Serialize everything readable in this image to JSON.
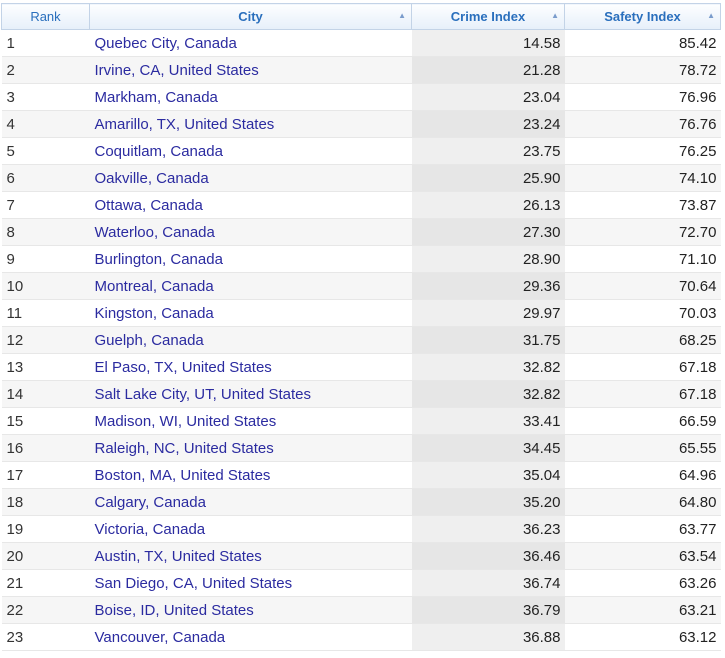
{
  "headers": {
    "rank": "Rank",
    "city": "City",
    "crime": "Crime Index",
    "safety": "Safety Index",
    "sort_glyph": "▲"
  },
  "rows": [
    {
      "rank": "1",
      "city": "Quebec City, Canada",
      "crime": "14.58",
      "safety": "85.42"
    },
    {
      "rank": "2",
      "city": "Irvine, CA, United States",
      "crime": "21.28",
      "safety": "78.72"
    },
    {
      "rank": "3",
      "city": "Markham, Canada",
      "crime": "23.04",
      "safety": "76.96"
    },
    {
      "rank": "4",
      "city": "Amarillo, TX, United States",
      "crime": "23.24",
      "safety": "76.76"
    },
    {
      "rank": "5",
      "city": "Coquitlam, Canada",
      "crime": "23.75",
      "safety": "76.25"
    },
    {
      "rank": "6",
      "city": "Oakville, Canada",
      "crime": "25.90",
      "safety": "74.10"
    },
    {
      "rank": "7",
      "city": "Ottawa, Canada",
      "crime": "26.13",
      "safety": "73.87"
    },
    {
      "rank": "8",
      "city": "Waterloo, Canada",
      "crime": "27.30",
      "safety": "72.70"
    },
    {
      "rank": "9",
      "city": "Burlington, Canada",
      "crime": "28.90",
      "safety": "71.10"
    },
    {
      "rank": "10",
      "city": "Montreal, Canada",
      "crime": "29.36",
      "safety": "70.64"
    },
    {
      "rank": "11",
      "city": "Kingston, Canada",
      "crime": "29.97",
      "safety": "70.03"
    },
    {
      "rank": "12",
      "city": "Guelph, Canada",
      "crime": "31.75",
      "safety": "68.25"
    },
    {
      "rank": "13",
      "city": "El Paso, TX, United States",
      "crime": "32.82",
      "safety": "67.18"
    },
    {
      "rank": "14",
      "city": "Salt Lake City, UT, United States",
      "crime": "32.82",
      "safety": "67.18"
    },
    {
      "rank": "15",
      "city": "Madison, WI, United States",
      "crime": "33.41",
      "safety": "66.59"
    },
    {
      "rank": "16",
      "city": "Raleigh, NC, United States",
      "crime": "34.45",
      "safety": "65.55"
    },
    {
      "rank": "17",
      "city": "Boston, MA, United States",
      "crime": "35.04",
      "safety": "64.96"
    },
    {
      "rank": "18",
      "city": "Calgary, Canada",
      "crime": "35.20",
      "safety": "64.80"
    },
    {
      "rank": "19",
      "city": "Victoria, Canada",
      "crime": "36.23",
      "safety": "63.77"
    },
    {
      "rank": "20",
      "city": "Austin, TX, United States",
      "crime": "36.46",
      "safety": "63.54"
    },
    {
      "rank": "21",
      "city": "San Diego, CA, United States",
      "crime": "36.74",
      "safety": "63.26"
    },
    {
      "rank": "22",
      "city": "Boise, ID, United States",
      "crime": "36.79",
      "safety": "63.21"
    },
    {
      "rank": "23",
      "city": "Vancouver, Canada",
      "crime": "36.88",
      "safety": "63.12"
    }
  ]
}
